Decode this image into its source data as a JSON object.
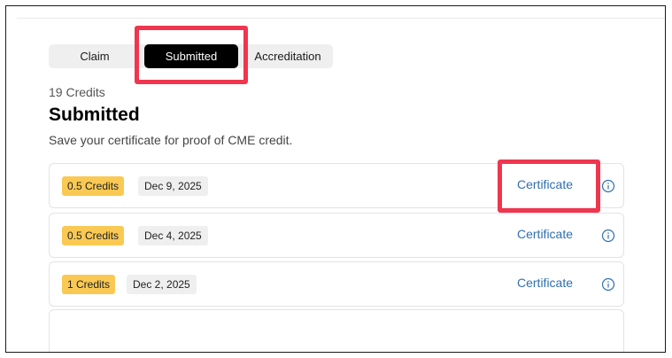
{
  "tabs": {
    "claim": "Claim",
    "submitted": "Submitted",
    "accreditation": "Accreditation",
    "active": "Submitted"
  },
  "header": {
    "credits_total": "19 Credits",
    "title": "Submitted",
    "subtitle": "Save your certificate for proof of CME credit."
  },
  "rows": [
    {
      "credits": "0.5 Credits",
      "date": "Dec 9, 2025",
      "action": "Certificate"
    },
    {
      "credits": "0.5 Credits",
      "date": "Dec 4, 2025",
      "action": "Certificate"
    },
    {
      "credits": "1 Credits",
      "date": "Dec 2, 2025",
      "action": "Certificate"
    }
  ],
  "icons": {
    "row_info": "info-circle-icon"
  },
  "colors": {
    "accent_link": "#2f6fb1",
    "credit_badge": "#f9c953",
    "active_tab": "#000000",
    "annotation": "#f0364f"
  }
}
